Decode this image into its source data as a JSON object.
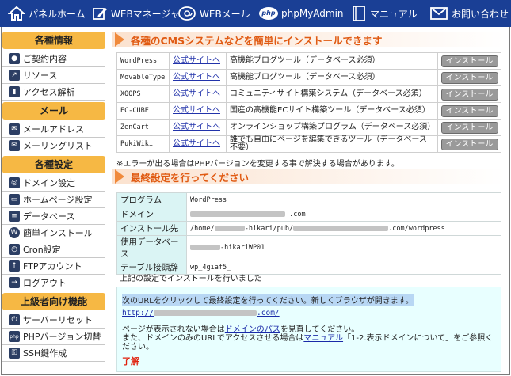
{
  "nav": {
    "home": "パネルホーム",
    "web": "WEBマネージャ",
    "mail": "WEBメール",
    "pma": "phpMyAdmin",
    "pma_badge": "php",
    "manual": "マニュアル",
    "contact": "お問い合わせ"
  },
  "sidebar": {
    "info_head": "各種情報",
    "contract": "ご契約内容",
    "resources": "リソース",
    "access": "アクセス解析",
    "mail_head": "メール",
    "mail_address": "メールアドレス",
    "mailing_list": "メーリングリスト",
    "settings_head": "各種設定",
    "domain": "ドメイン設定",
    "homepage": "ホームページ設定",
    "database": "データベース",
    "easy_install": "簡単インストール",
    "cron": "Cron設定",
    "ftp": "FTPアカウント",
    "logout": "ログアウト",
    "advanced_head": "上級者向け機能",
    "server_reset": "サーバーリセット",
    "php_version": "PHPバージョン切替",
    "ssh": "SSH鍵作成"
  },
  "cms_section": {
    "title": "各種のCMSシステムなどを簡単にインストールできます",
    "link_label": "公式サイトへ",
    "button_label": "インストール",
    "rows": [
      {
        "name": "WordPress",
        "desc": "高機能ブログツール（データベース必須）"
      },
      {
        "name": "MovableType",
        "desc": "高機能ブログツール（データベース必須）"
      },
      {
        "name": "XOOPS",
        "desc": "コミュニティサイト構築システム（データベース必須）"
      },
      {
        "name": "EC-CUBE",
        "desc": "国産の高機能ECサイト構築ツール（データベース必須）"
      },
      {
        "name": "ZenCart",
        "desc": "オンラインショップ構築プログラム（データベース必須）"
      },
      {
        "name": "PukiWiki",
        "desc": "誰でも自由にページを編集できるツール（データベース不要）"
      }
    ],
    "note": "※エラーが出る場合はPHPバージョンを変更する事で解決する場合があります。"
  },
  "final_section": {
    "title": "最終設定を行ってください",
    "rows": {
      "program_label": "プログラム",
      "program_value": "WordPress",
      "domain_label": "ドメイン",
      "domain_suffix": ".com",
      "path_label": "インストール先",
      "path_prefix": "/home/",
      "path_mid": "-hikari/pub/",
      "path_suffix": ".com/wordpress",
      "db_label": "使用データベース",
      "db_value": "-hikariWP01",
      "prefix_label": "テーブル接頭辞",
      "prefix_value": "wp_4giaf5_"
    },
    "do_install": "上記の設定でインストールを行いました",
    "click_text": "次のURLをクリックして最終設定を行ってください。新しくブラウザが開きます。",
    "url_prefix": "http://",
    "url_suffix": ".com/",
    "help1_pre": "ページが表示されない場合は",
    "help1_link": "ドメインのパス",
    "help1_post": "を見直してください。",
    "help2_pre": "また、ドメインのみのURLでアクセスさせる場合は",
    "help2_link": "マニュアル",
    "help2_post": "「1-2.表示ドメインについて」をご参照ください。",
    "ok": "了解"
  }
}
